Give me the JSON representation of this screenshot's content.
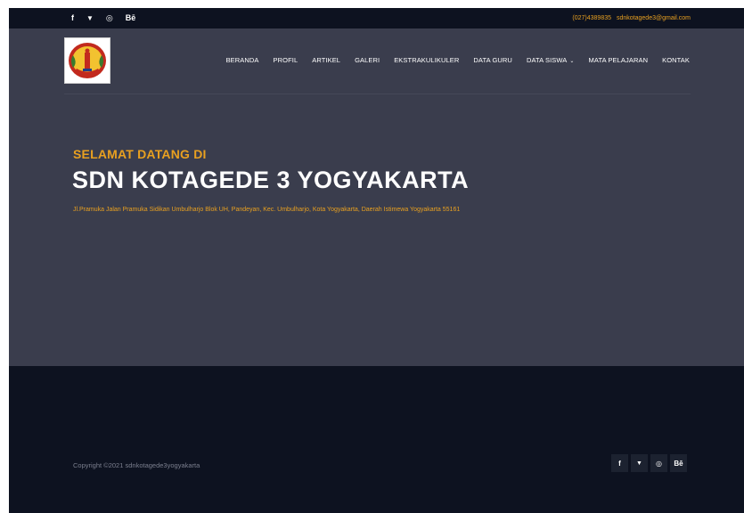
{
  "topbar": {
    "social": [
      {
        "icon": "facebook-icon",
        "glyph": "f"
      },
      {
        "icon": "twitter-icon",
        "glyph": "🐦"
      },
      {
        "icon": "dribbble-icon",
        "glyph": "◎"
      },
      {
        "icon": "behance-icon",
        "glyph": "Bē"
      }
    ],
    "phone": "(027)4389835",
    "email": "sdnkotagede3@gmail.com"
  },
  "nav": {
    "items": [
      {
        "name": "nav-beranda",
        "label": "BERANDA"
      },
      {
        "name": "nav-profil",
        "label": "PROFIL"
      },
      {
        "name": "nav-artikel",
        "label": "ARTIKEL"
      },
      {
        "name": "nav-galeri",
        "label": "GALERI"
      },
      {
        "name": "nav-ekstrakulikuler",
        "label": "EKSTRAKULIKULER"
      },
      {
        "name": "nav-data-guru",
        "label": "DATA GURU"
      },
      {
        "name": "nav-data-siswa",
        "label": "DATA SISWA",
        "dropdown": true
      },
      {
        "name": "nav-mata-pelajaran",
        "label": "MATA PELAJARAN"
      },
      {
        "name": "nav-kontak",
        "label": "KONTAK"
      }
    ]
  },
  "hero": {
    "welcome": "SELAMAT DATANG DI",
    "school_name": "SDN KOTAGEDE 3 YOGYAKARTA",
    "address": "Jl.Pramuka Jalan Pramuka Sidikan Umbulharjo Blok UH, Pandeyan, Kec. Umbulharjo, Kota Yogyakarta, Daerah Istimewa Yogyakarta 55161"
  },
  "footer": {
    "copyright": "Copyright ©2021 sdnkotagede3yogyakarta",
    "social": [
      {
        "icon": "facebook-icon",
        "glyph": "f"
      },
      {
        "icon": "twitter-icon",
        "glyph": "🐦"
      },
      {
        "icon": "dribbble-icon",
        "glyph": "◎"
      },
      {
        "icon": "behance-icon",
        "glyph": "Bē"
      }
    ]
  },
  "colors": {
    "accent": "#e8a020",
    "hero_bg": "#3a3d4d",
    "dark_bg": "#0d1220"
  }
}
